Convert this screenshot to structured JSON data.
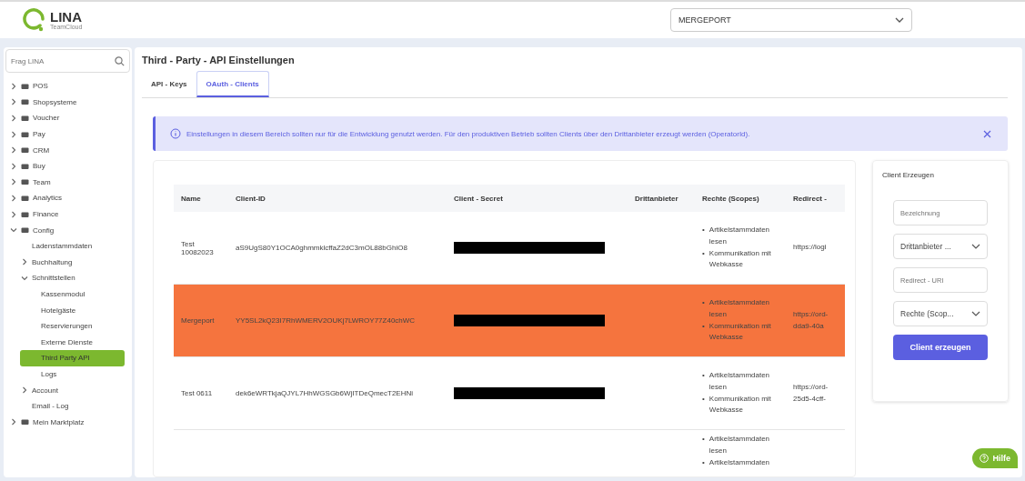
{
  "logo": {
    "name": "LINA",
    "subtitle": "TeamCloud"
  },
  "company_select": {
    "value": "MERGEPORT"
  },
  "sidebar": {
    "search": {
      "placeholder": "Frag LINA"
    },
    "items": [
      {
        "label": "POS",
        "expanded": false,
        "selected": false
      },
      {
        "label": "Shopsysteme",
        "expanded": false,
        "selected": false
      },
      {
        "label": "Voucher",
        "expanded": false,
        "selected": false
      },
      {
        "label": "Pay",
        "expanded": false,
        "selected": false
      },
      {
        "label": "CRM",
        "expanded": false,
        "selected": false
      },
      {
        "label": "Buy",
        "expanded": false,
        "selected": false
      },
      {
        "label": "Team",
        "expanded": false,
        "selected": false
      },
      {
        "label": "Analytics",
        "expanded": false,
        "selected": false
      },
      {
        "label": "Finance",
        "expanded": false,
        "selected": false
      },
      {
        "label": "Config",
        "expanded": true,
        "selected": false,
        "children": [
          {
            "label": "Ladenstammdaten",
            "selected": false
          },
          {
            "label": "Buchhaltung",
            "expanded": false,
            "selected": false
          },
          {
            "label": "Schnittstellen",
            "expanded": true,
            "selected": false,
            "children": [
              {
                "label": "Kassenmodul",
                "selected": false
              },
              {
                "label": "Hotelgäste",
                "selected": false
              },
              {
                "label": "Reservierungen",
                "selected": false
              },
              {
                "label": "Externe Dienste",
                "selected": false
              },
              {
                "label": "Third Party API",
                "selected": true
              },
              {
                "label": "Logs",
                "selected": false
              }
            ]
          },
          {
            "label": "Account",
            "expanded": false,
            "selected": false
          },
          {
            "label": "Email - Log",
            "selected": false
          }
        ]
      },
      {
        "label": "Mein Marktplatz",
        "expanded": false,
        "selected": false
      }
    ]
  },
  "page_title": "Third - Party - API Einstellungen",
  "tabs": [
    {
      "label": "API - Keys",
      "selected": false
    },
    {
      "label": "OAuth - Clients",
      "selected": true
    }
  ],
  "alert": {
    "text": "Einstellungen in diesem Bereich sollten nur für die Entwicklung genutzt werden. Für den produktiven Betrieb sollten Clients über den Drittanbieter erzeugt werden (OperatorId)."
  },
  "table": {
    "columns": [
      "Name",
      "Client-ID",
      "Client - Secret",
      "Drittanbieter",
      "Rechte (Scopes)",
      "Redirect -"
    ],
    "rows": [
      {
        "name": "Test 10082023",
        "client_id": "aS9UgS80Y1OCA0ghmmklcffaZ2dC3mOL88bGhiO8",
        "secret_redacted": true,
        "scopes": [
          {
            "bullet": "•",
            "text": "Artikelstammdaten lesen"
          },
          {
            "bullet": "•",
            "text": "Kommunikation mit Webkasse"
          }
        ],
        "redirect": [
          "https://logi"
        ],
        "selected": false
      },
      {
        "name": "Mergeport",
        "client_id": "YY5SL2kQ23I7RhWMERV2OUKj7LWROY77Z40chWC",
        "secret_redacted": true,
        "scopes": [
          {
            "bullet": "•",
            "text": "Artikelstammdaten lesen"
          },
          {
            "bullet": "•",
            "text": "Kommunikation mit Webkasse"
          }
        ],
        "redirect": [
          "https://ord-",
          "dda9-40a"
        ],
        "selected": true
      },
      {
        "name": "Test 0611",
        "client_id": "dek6eWRTkjaQJYL7HhWGSGb6WjITDeQmecT2EHNi",
        "secret_redacted": true,
        "scopes": [
          {
            "bullet": "•",
            "text": "Artikelstammdaten lesen"
          },
          {
            "bullet": "•",
            "text": "Kommunikation mit Webkasse"
          }
        ],
        "redirect": [
          "https://ord-",
          "25d5-4cff-"
        ],
        "selected": false
      },
      {
        "scopes": [
          {
            "bullet": "•",
            "text": "Artikelstammdaten lesen"
          },
          {
            "bullet": "•",
            "text": "Artikelstammdaten"
          }
        ],
        "selected": false
      }
    ]
  },
  "create_client": {
    "title": "Client Erzeugen",
    "fields": [
      {
        "kind": "input",
        "placeholder": "Bezeichnung"
      },
      {
        "kind": "select",
        "value": "Drittanbieter ..."
      },
      {
        "kind": "input",
        "placeholder": "Redirect - URI"
      },
      {
        "kind": "select",
        "value": "Rechte (Scop..."
      }
    ],
    "button": "Client erzeugen"
  },
  "help_button": "Hilfe"
}
